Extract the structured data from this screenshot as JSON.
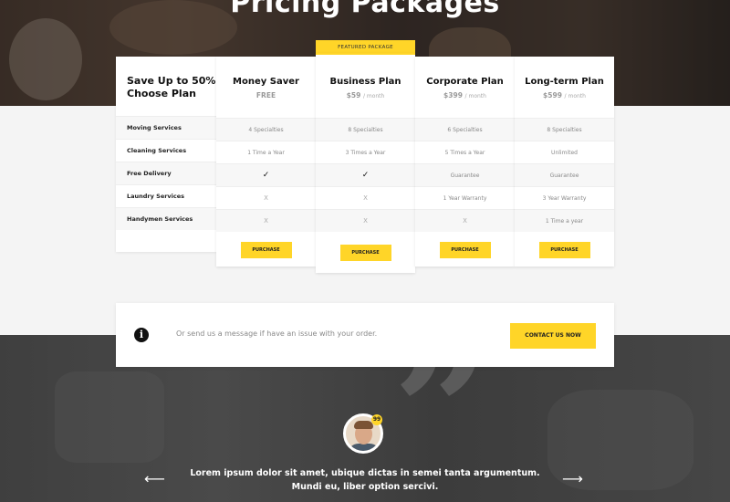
{
  "hero": {
    "title": "Pricing Packages"
  },
  "pricing": {
    "label_header": "Save Up to 50% Choose Plan",
    "rows": [
      "Moving Services",
      "Cleaning Services",
      "Free Delivery",
      "Laundry Services",
      "Handymen Services"
    ],
    "featured_badge": "FEATURED PACKAGE",
    "plans": [
      {
        "name": "Money Saver",
        "price": "FREE",
        "period": "",
        "cells": [
          "4 Specialties",
          "1 Time a Year",
          "✓",
          "X",
          "X"
        ],
        "purchase": "PURCHASE"
      },
      {
        "name": "Business Plan",
        "price": "$59",
        "period": "/ month",
        "cells": [
          "8 Specialties",
          "3 Times a Year",
          "✓",
          "X",
          "X"
        ],
        "purchase": "PURCHASE"
      },
      {
        "name": "Corporate Plan",
        "price": "$399",
        "period": "/ month",
        "cells": [
          "6 Specialties",
          "5 Times a Year",
          "Guarantee",
          "1 Year Warranty",
          "X"
        ],
        "purchase": "PURCHASE"
      },
      {
        "name": "Long-term Plan",
        "price": "$599",
        "period": "/ month",
        "cells": [
          "8 Specialties",
          "Unlimited",
          "Guarantee",
          "3 Year Warranty",
          "1 Time a year"
        ],
        "purchase": "PURCHASE"
      }
    ]
  },
  "contact": {
    "icon": "info-icon",
    "text": "Or send us a message if have an issue with your order.",
    "button": "CONTACT US NOW"
  },
  "testimonial": {
    "quote_icon": "quote-icon",
    "badge": "99",
    "text": "Lorem ipsum dolor sit amet, ubique dictas in semei tanta argumentum. Mundi eu, liber option sercivi.",
    "prev_icon": "arrow-left-icon",
    "next_icon": "arrow-right-icon"
  },
  "colors": {
    "accent": "#ffd528",
    "dark": "#3f3f3f"
  }
}
